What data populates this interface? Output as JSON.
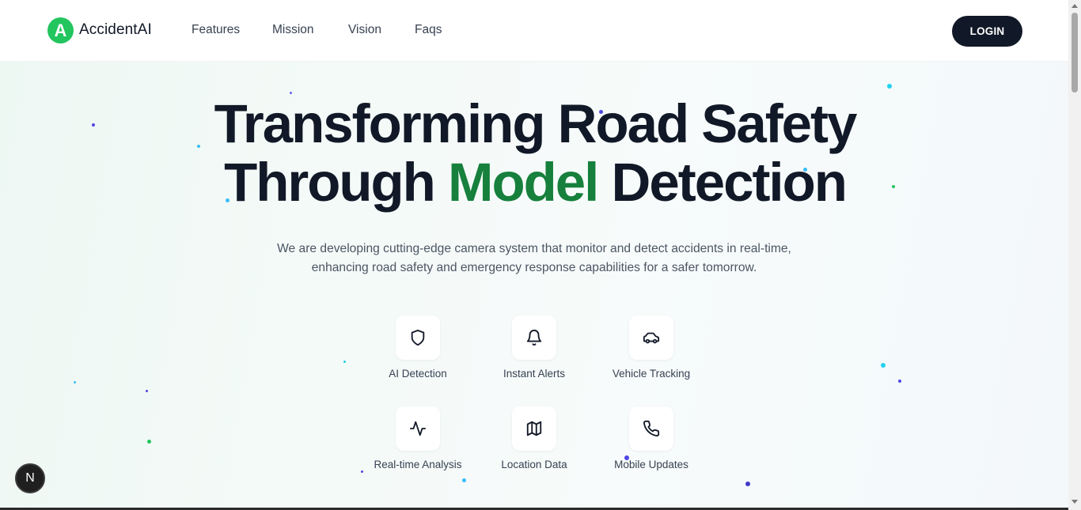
{
  "brand": {
    "logo_letter": "A",
    "name": "AccidentAI",
    "accent_color": "#22c55e"
  },
  "nav": {
    "links": [
      "Features",
      "Mission",
      "Vision",
      "Faqs"
    ],
    "login_label": "LOGIN"
  },
  "hero": {
    "line1": "Transforming Road Safety",
    "line2_before": "Through ",
    "line2_accent": "Model",
    "line2_after": " Detection",
    "accent_color": "#16803c",
    "subtitle": "We are developing cutting-edge camera system that monitor and detect accidents in real-time, enhancing road safety and emergency response capabilities for a safer tomorrow."
  },
  "features": [
    {
      "icon": "shield-icon",
      "label": "AI Detection"
    },
    {
      "icon": "bell-icon",
      "label": "Instant Alerts"
    },
    {
      "icon": "car-icon",
      "label": "Vehicle Tracking"
    },
    {
      "icon": "activity-icon",
      "label": "Real-time Analysis"
    },
    {
      "icon": "map-icon",
      "label": "Location Data"
    },
    {
      "icon": "phone-icon",
      "label": "Mobile Updates"
    }
  ],
  "dev_badge": {
    "letter": "N"
  }
}
